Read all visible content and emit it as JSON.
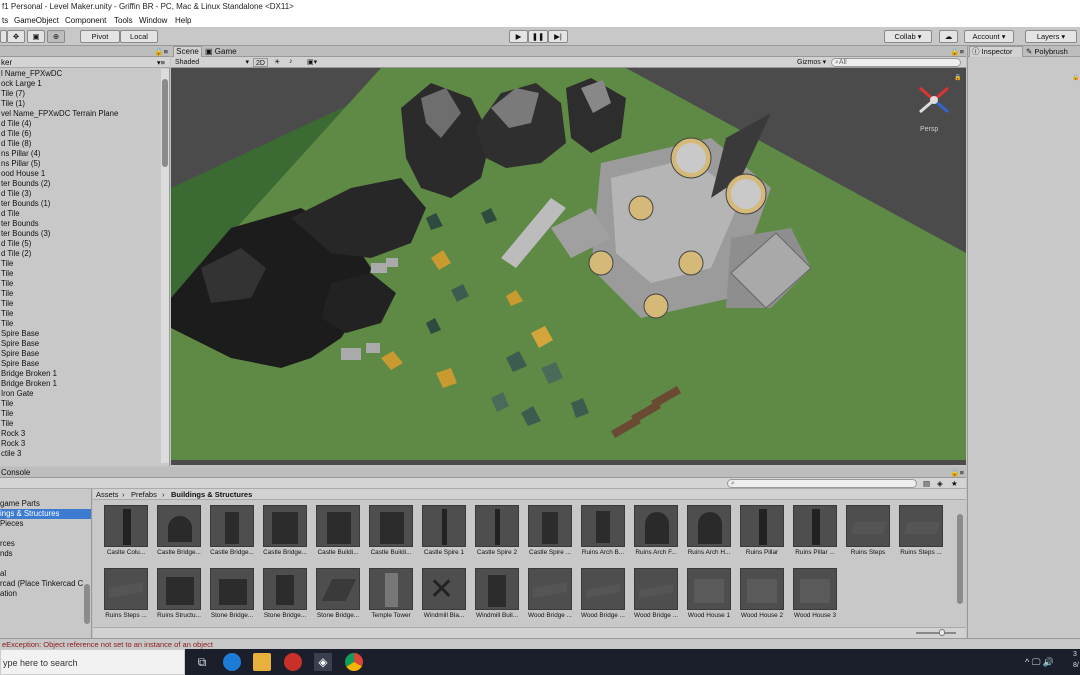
{
  "window_title": "f1 Personal - Level Maker.unity - Griffin BR - PC, Mac & Linux Standalone <DX11>",
  "menu": [
    "ts",
    "GameObject",
    "Component",
    "Tools",
    "Window",
    "Help"
  ],
  "toolbar": {
    "pivot": "Pivot",
    "local": "Local",
    "collab": "Collab ▾",
    "account": "Account ▾",
    "layers": "Layers ▾"
  },
  "hierarchy": {
    "tab": "ker",
    "items": [
      "l Name_FPXwDC",
      "ock Large 1",
      "Tile (7)",
      "Tile (1)",
      "vel Name_FPXwDC Terrain Plane",
      "d Tile (4)",
      "d Tile (6)",
      "d Tile (8)",
      "ns Pillar (4)",
      "ns Pillar (5)",
      "ood House 1",
      "ter Bounds (2)",
      "d Tile (3)",
      "ter Bounds (1)",
      "d Tile",
      "ter Bounds",
      "ter Bounds (3)",
      "d Tile (5)",
      "d Tile (2)",
      "Tile",
      "Tile",
      "Tile",
      "Tile",
      "Tile",
      "Tile",
      "Tile",
      "Spire Base",
      "Spire Base",
      "Spire Base",
      "Spire Base",
      "Bridge Broken 1",
      "Bridge Broken 1",
      "Iron Gate",
      "Tile",
      "Tile",
      "Tile",
      "Rock 3",
      "Rock 3",
      "ctile 3"
    ]
  },
  "scene": {
    "tab_scene": "Scene",
    "tab_game": "Game",
    "shading": "Shaded",
    "mode_2d": "2D",
    "gizmos": "Gizmos ▾",
    "search_placeholder": "All",
    "persp": "Persp"
  },
  "inspector": {
    "tab_inspector": "Inspector",
    "tab_polybrush": "Polybrush"
  },
  "project": {
    "tab": "Console",
    "folders": [
      "",
      "game Parts",
      "ings & Structures",
      "Pieces",
      "",
      "rces",
      "nds",
      "",
      "al",
      "rcad (Place Tinkercad C",
      "ation"
    ],
    "breadcrumb": [
      "Assets",
      "Prefabs",
      "Buildings & Structures"
    ],
    "assets": [
      "Caslte Colu...",
      "Castle Bridge...",
      "Castle Bridge...",
      "Castle Bridge...",
      "Castle Buildi...",
      "Castle Buildi...",
      "Castle Spire 1",
      "Castle Spire 2",
      "Castle Spire ...",
      "Ruins Arch B...",
      "Ruins Arch F...",
      "Ruins Arch H...",
      "Ruins Pillar",
      "Ruins Pillar ...",
      "Ruins Steps",
      "Ruins Steps ...",
      "Ruins Steps ...",
      "Ruins Structu...",
      "Stone Bridge...",
      "Stone Bridge...",
      "Stone Bridge...",
      "Temple Tower",
      "Windmill Bla...",
      "Windmill Buil...",
      "Wood Bridge ...",
      "Wood Bridge ...",
      "Wood Bridge ...",
      "Wood House 1",
      "Wood House 2",
      "Wood House 3"
    ]
  },
  "status": "eException: Object reference not set to an instance of an object",
  "taskbar": {
    "search_text": "ype here to search",
    "clock1": "3",
    "clock2": "8/"
  }
}
